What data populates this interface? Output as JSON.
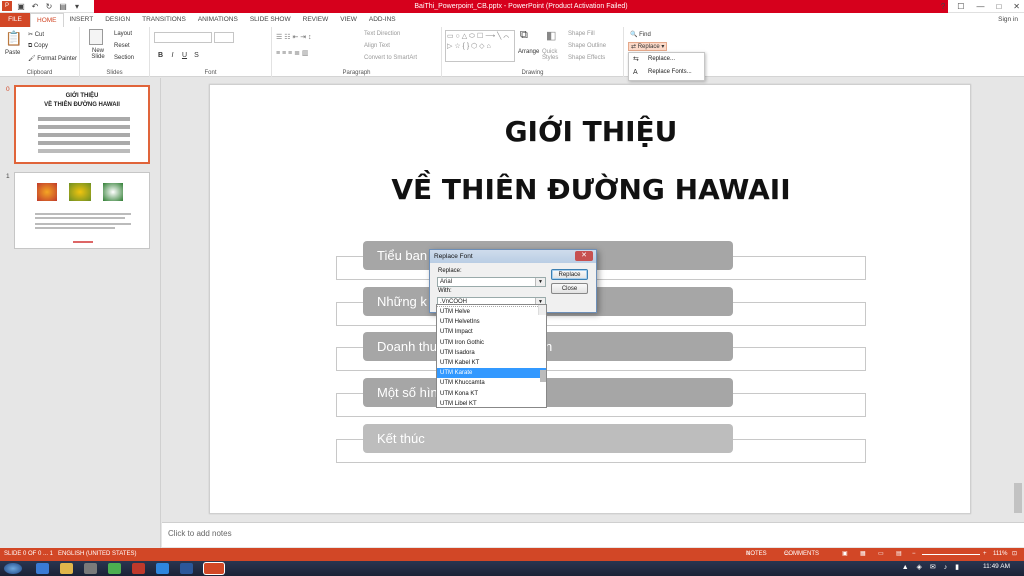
{
  "window": {
    "title": "BaiThi_Powerpoint_CB.pptx - PowerPoint (Product Activation Failed)",
    "controls": [
      "?",
      "☐",
      "—",
      "□",
      "✕"
    ]
  },
  "tabs": [
    "FILE",
    "HOME",
    "INSERT",
    "DESIGN",
    "TRANSITIONS",
    "ANIMATIONS",
    "SLIDE SHOW",
    "REVIEW",
    "VIEW",
    "ADD-INS"
  ],
  "signin": "Sign in",
  "ribbon": {
    "clipboard": {
      "paste": "Paste",
      "cut": "Cut",
      "copy": "Copy",
      "format_painter": "Format Painter",
      "label": "Clipboard"
    },
    "slides": {
      "new_slide": "New Slide",
      "layout": "Layout",
      "reset": "Reset",
      "section": "Section",
      "label": "Slides"
    },
    "font": {
      "bold": "B",
      "italic": "I",
      "underline": "U",
      "strike": "S",
      "label": "Font"
    },
    "paragraph": {
      "text_direction": "Text Direction",
      "align_text": "Align Text",
      "convert_smartart": "Convert to SmartArt",
      "label": "Paragraph"
    },
    "drawing": {
      "arrange": "Arrange",
      "quick_styles": "Quick Styles",
      "shape_fill": "Shape Fill",
      "shape_outline": "Shape Outline",
      "shape_effects": "Shape Effects",
      "label": "Drawing"
    },
    "editing": {
      "find": "Find",
      "replace": "Replace"
    }
  },
  "replace_menu": {
    "replace": "Replace...",
    "replace_fonts": "Replace Fonts..."
  },
  "thumbnails": {
    "slide0": {
      "number": "0",
      "title1": "GIỚI THIỆU",
      "title2": "VỀ THIÊN ĐƯỜNG HAWAII"
    },
    "slide1": {
      "number": "1"
    }
  },
  "slide": {
    "title1": "GIỚI THIỆU",
    "title2": "VỀ THIÊN ĐƯỜNG HAWAII",
    "items": [
      "Tiểu ban",
      "Những k",
      "Doanh thu",
      "Một số hìn",
      "Kết thúc"
    ],
    "item3_tail": "n"
  },
  "notes_placeholder": "Click to add notes",
  "dialog": {
    "title": "Replace Font",
    "replace_label": "Replace:",
    "replace_value": "Arial",
    "with_label": "With:",
    "with_value": ".VnCOOH",
    "replace_button": "Replace",
    "close_button": "Close"
  },
  "font_list": [
    "UTM Helve",
    "UTM HelvetIns",
    "UTM Impact",
    "UTM Iron Gothic",
    "UTM Isadora",
    "UTM Kabel KT",
    "UTM Karate",
    "UTM Khuccamta",
    "UTM Kona KT",
    "UTM Libel KT"
  ],
  "font_list_selected": "UTM Karate",
  "status": {
    "slide": "SLIDE 0 OF 0 ... 1",
    "language": "ENGLISH (UNITED STATES)",
    "notes": "NOTES",
    "comments": "COMMENTS",
    "zoom": "111%"
  },
  "taskbar": {
    "time": "11:49 AM"
  },
  "colors": {
    "accent": "#d24726",
    "title_bar": "#d6001c",
    "highlight": "#3399ff"
  }
}
